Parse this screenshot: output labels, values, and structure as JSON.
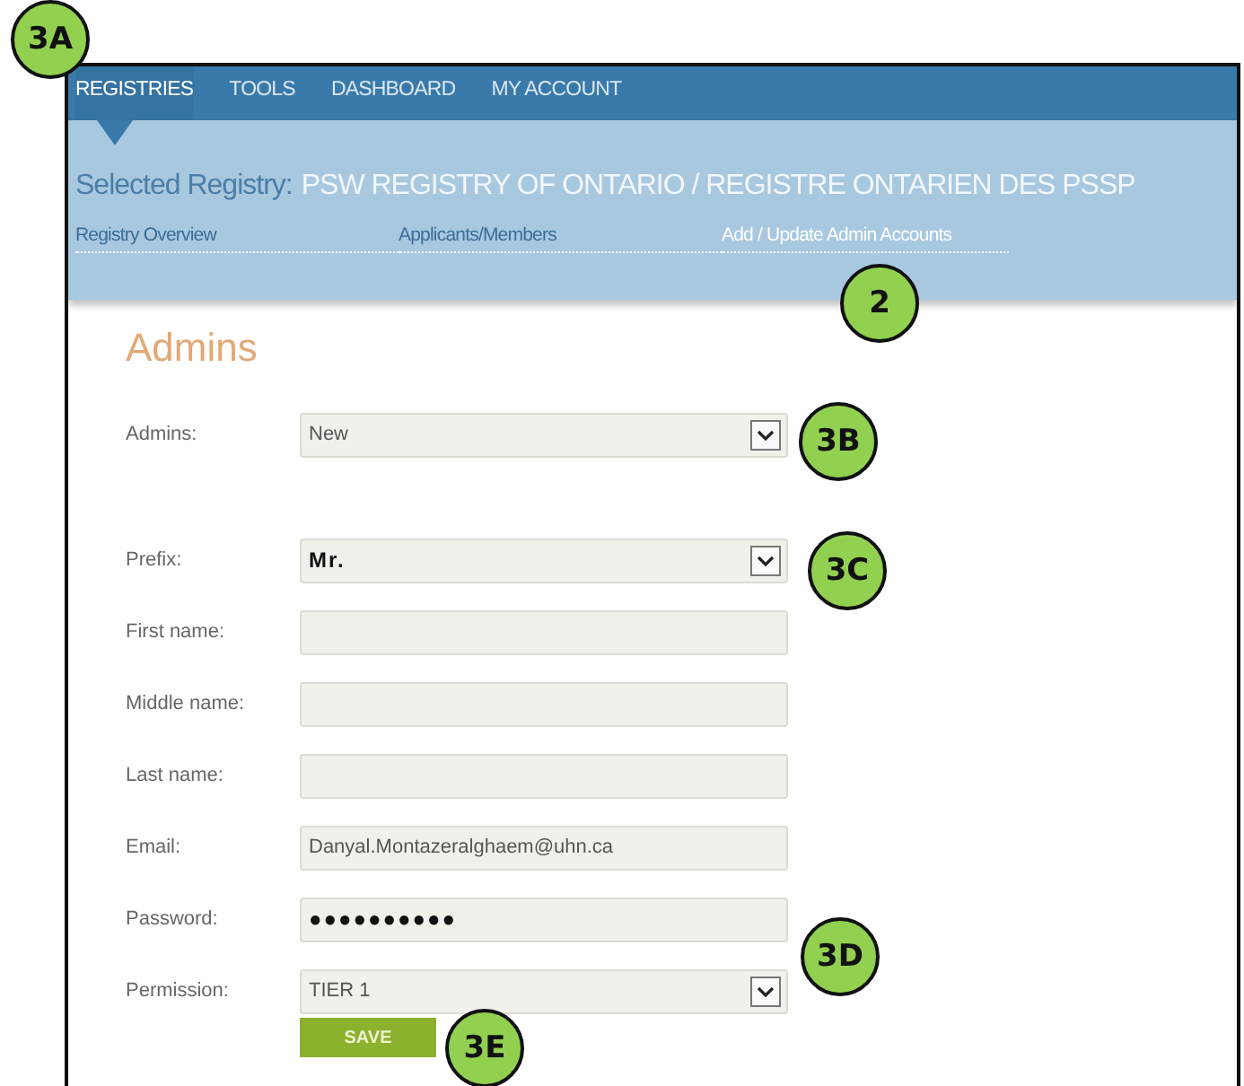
{
  "nav": [
    {
      "label": "REGISTRIES",
      "selected": true
    },
    {
      "label": "TOOLS",
      "selected": false
    },
    {
      "label": "DASHBOARD",
      "selected": false
    },
    {
      "label": "MY ACCOUNT",
      "selected": false
    }
  ],
  "registry": {
    "label": "Selected Registry:",
    "value": "PSW REGISTRY OF ONTARIO / REGISTRE ONTARIEN DES PSSP"
  },
  "subnav": [
    {
      "label": "Registry Overview",
      "selected": false
    },
    {
      "label": "Applicants/Members",
      "selected": false
    },
    {
      "label": "Add / Update Admin Accounts",
      "selected": true
    }
  ],
  "heading": "Admins",
  "fields": [
    {
      "kind": "select",
      "label": "Admins:",
      "value": "New"
    },
    {
      "kind": "select",
      "label": "Prefix:",
      "value": "Mr."
    },
    {
      "kind": "text",
      "label": "First name:"
    },
    {
      "kind": "text",
      "label": "Middle name:"
    },
    {
      "kind": "text",
      "label": "Last name:"
    },
    {
      "kind": "text",
      "label": "Email:",
      "value": "Danyal.Montazeralghaem@uhn.ca"
    },
    {
      "kind": "password",
      "label": "Password:",
      "value": "●●●●●●●●●●"
    },
    {
      "kind": "select",
      "label": "Permission:",
      "value": "TIER 1"
    }
  ],
  "save_button": "SAVE",
  "callouts": [
    {
      "label": "3A"
    },
    {
      "label": "2"
    },
    {
      "label": "3B"
    },
    {
      "label": "3C"
    },
    {
      "label": "3D"
    },
    {
      "label": "3E"
    }
  ]
}
